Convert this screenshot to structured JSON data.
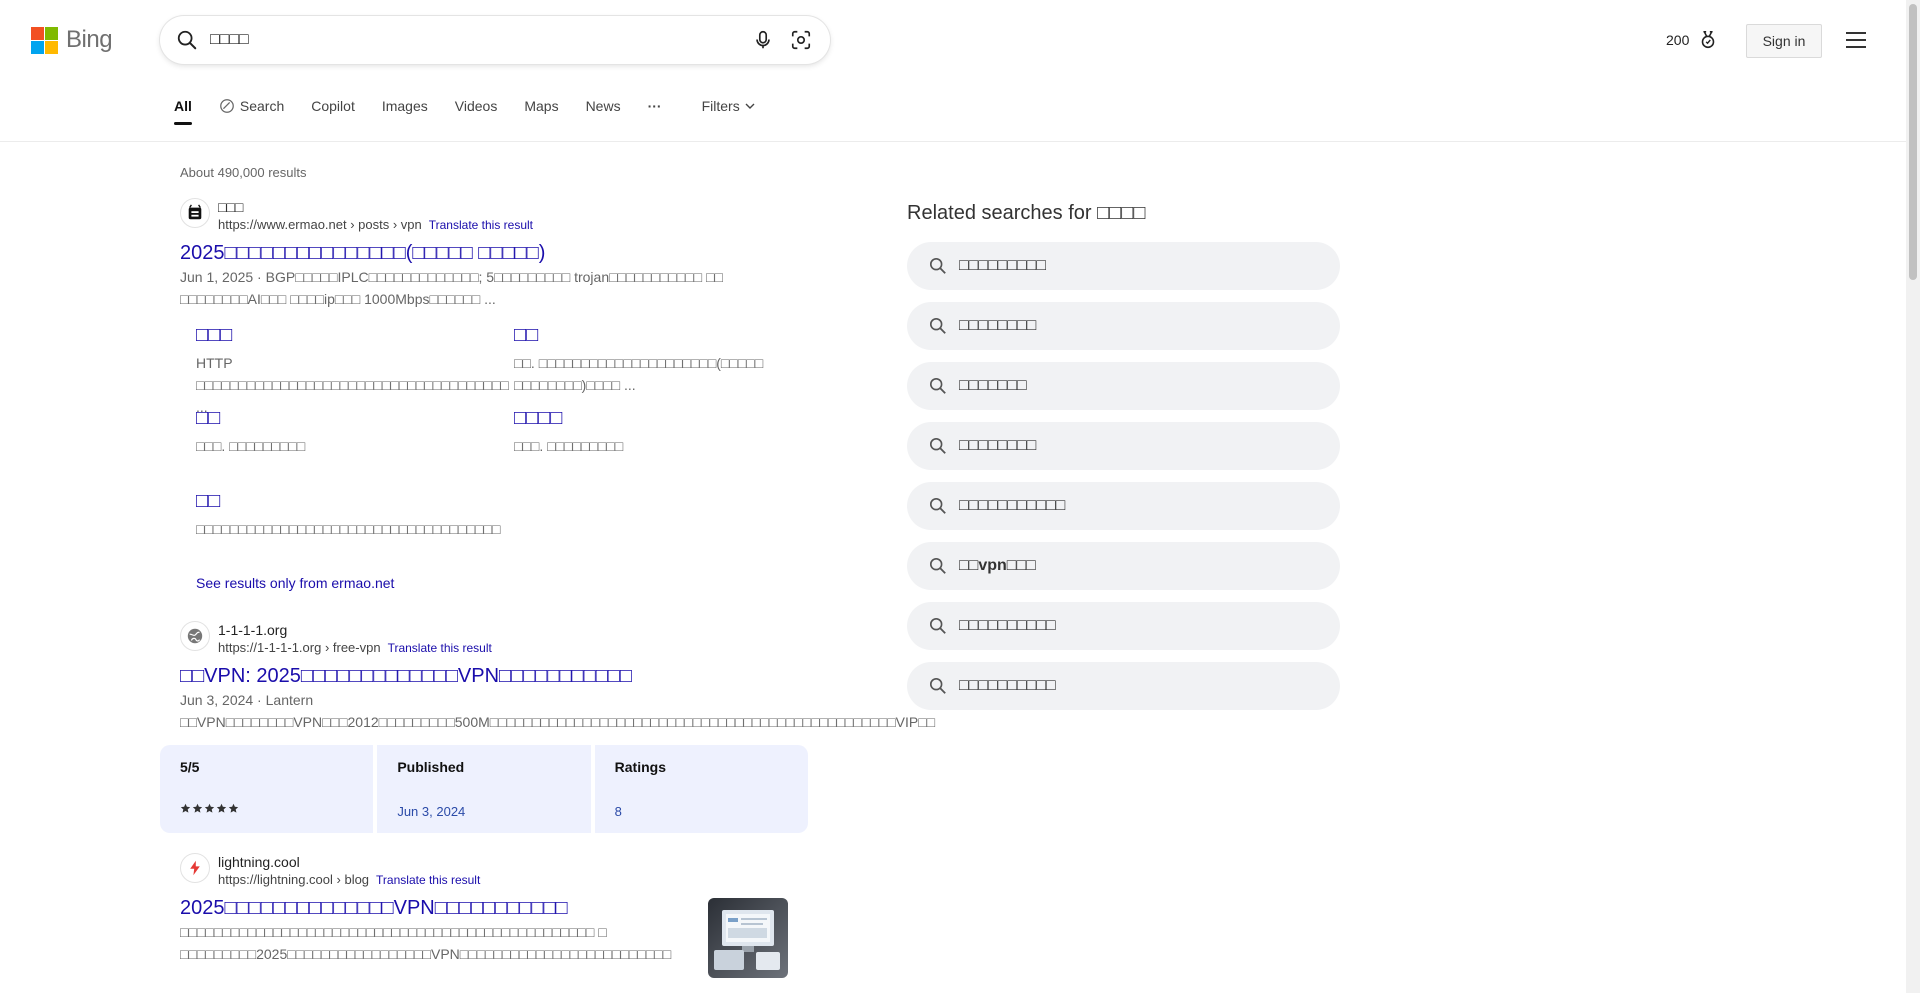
{
  "header": {
    "logo_text": "Bing",
    "search_value": "□□□□",
    "rewards_points": "200",
    "sign_in": "Sign in"
  },
  "nav": {
    "all": "All",
    "search": "Search",
    "copilot": "Copilot",
    "images": "Images",
    "videos": "Videos",
    "maps": "Maps",
    "news": "News",
    "more": "···",
    "filters": "Filters"
  },
  "results_count": "About 490,000 results",
  "results": [
    {
      "site_name": "□□□",
      "url": "https://www.ermao.net › posts › vpn",
      "translate": "Translate this result",
      "title": "2025□□□□□□□□□□□□□□□(□□□□□ □□□□□)",
      "date": "Jun 1, 2025 · ",
      "snippet": "BGP□□□□□IPLC□□□□□□□□□□□□□; 5□□□□□□□□□ trojan□□□□□□□□□□□ □□ □□□□□□□□AI□□□ □□□□ip□□□ 1000Mbps□□□□□□ ...",
      "deeplinks": [
        {
          "title": "□□□",
          "desc": "HTTP □□□□□□□□□□□□□□□□□□□□□□□□□□□□□□□□□□□□□ ..."
        },
        {
          "title": "□□",
          "desc": "□□. □□□□□□□□□□□□□□□□□□□□□(□□□□□ □□□□□□□□)□□□□ ..."
        },
        {
          "title": "□□",
          "desc": "□□□. □□□□□□□□□"
        },
        {
          "title": "□□□□",
          "desc": "□□□. □□□□□□□□□"
        },
        {
          "title": "□□",
          "desc": "□□□□□□□□□□□□□□□□□□□□□□□□□□□□□□□□□□□□"
        }
      ],
      "see_only": "See results only from ermao.net"
    },
    {
      "site_name": "1-1-1-1.org",
      "url": "https://1-1-1-1.org › free-vpn",
      "translate": "Translate this result",
      "title": "□□VPN: 2025□□□□□□□□□□□□□VPN□□□□□□□□□□□",
      "date": "Jun 3, 2024 · ",
      "snippet": "Lantern □□VPN□□□□□□□□VPN□□□2012□□□□□□□□□500M□□□□□□□□□□□□□□□□□□□□□□□□□□□□□□□□□□□□□□□□□□□□□□□□VIP□□ ...",
      "facts": [
        {
          "label": "5/5",
          "value": ""
        },
        {
          "label": "Published",
          "value": "Jun 3, 2024"
        },
        {
          "label": "Ratings",
          "value": "8"
        }
      ],
      "rating_stars": 5
    },
    {
      "site_name": "lightning.cool",
      "url": "https://lightning.cool › blog",
      "translate": "Translate this result",
      "title": "2025□□□□□□□□□□□□□□VPN□□□□□□□□□□□",
      "snippet": "□□□□□□□□□□□□□□□□□□□□□□□□□□□□□□□□□□□□□□□□□□□□□□□□□ □ □□□□□□□□□2025□□□□□□□□□□□□□□□□□VPN□□□□□□□□□□□□□□□□□□□□□□□□□"
    }
  ],
  "related": {
    "title": "Related searches for □□□□",
    "items": [
      "□□□□□□□□□",
      "□□□□□□□□",
      "□□□□□□□",
      "□□□□□□□□",
      "□□□□□□□□□□□",
      "□□vpn□□□",
      "□□□□□□□□□□",
      "□□□□□□□□□□"
    ]
  },
  "colors": {
    "link": "#1a0dab",
    "ms_red": "#f25022",
    "ms_green": "#7fba00",
    "ms_blue": "#00a4ef",
    "ms_yellow": "#ffb900",
    "facts_bg": "#eef1fe"
  },
  "icons": [
    "search-icon",
    "mic-icon",
    "visual-search-icon",
    "rewards-medal-icon",
    "menu-icon",
    "copilot-search-icon",
    "chevron-down-icon",
    "globe-icon",
    "lightning-icon",
    "star-icon"
  ]
}
